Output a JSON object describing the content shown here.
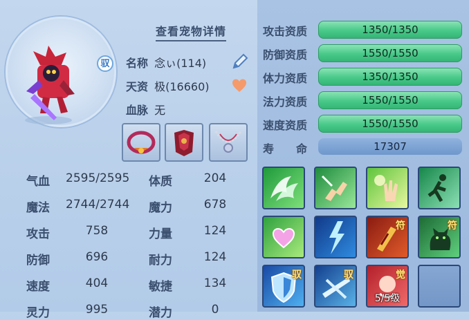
{
  "header": {
    "detail_link": "查看宠物详情"
  },
  "pet": {
    "badge": "驭",
    "name_label": "名称",
    "name_value": "念ぃ(114)",
    "talent_label": "天资",
    "talent_value": "极(16660)",
    "blood_label": "血脉",
    "blood_value": "无"
  },
  "equipment": [
    {
      "name": "collar-ornament"
    },
    {
      "name": "armor-ornament"
    },
    {
      "name": "necklace-ornament"
    }
  ],
  "stats": [
    {
      "label": "气血",
      "value": "2595/2595",
      "label2": "体质",
      "value2": "204"
    },
    {
      "label": "魔法",
      "value": "2744/2744",
      "label2": "魔力",
      "value2": "678"
    },
    {
      "label": "攻击",
      "value": "758",
      "label2": "力量",
      "value2": "124"
    },
    {
      "label": "防御",
      "value": "696",
      "label2": "耐力",
      "value2": "124"
    },
    {
      "label": "速度",
      "value": "404",
      "label2": "敏捷",
      "value2": "134"
    },
    {
      "label": "灵力",
      "value": "995",
      "label2": "潜力",
      "value2": "0"
    }
  ],
  "aptitudes": [
    {
      "label": "攻击资质",
      "value": "1350/1350"
    },
    {
      "label": "防御资质",
      "value": "1550/1550"
    },
    {
      "label": "体力资质",
      "value": "1350/1350"
    },
    {
      "label": "法力资质",
      "value": "1550/1550"
    },
    {
      "label": "速度资质",
      "value": "1550/1550"
    }
  ],
  "lifespan": {
    "label": "寿　　命",
    "value": "17307"
  },
  "skills": [
    {
      "icon": "wings-skill-icon",
      "tag": "",
      "level": ""
    },
    {
      "icon": "hand-gesture-skill-icon",
      "tag": "",
      "level": ""
    },
    {
      "icon": "palm-light-skill-icon",
      "tag": "",
      "level": ""
    },
    {
      "icon": "running-figure-skill-icon",
      "tag": "",
      "level": ""
    },
    {
      "icon": "heart-skill-icon",
      "tag": "",
      "level": ""
    },
    {
      "icon": "lightning-skill-icon",
      "tag": "",
      "level": ""
    },
    {
      "icon": "red-charm-skill-icon",
      "tag": "符",
      "level": ""
    },
    {
      "icon": "cat-spirit-skill-icon",
      "tag": "符",
      "level": ""
    },
    {
      "icon": "shield-skill-icon",
      "tag": "驭",
      "level": ""
    },
    {
      "icon": "ice-slash-skill-icon",
      "tag": "驭",
      "level": ""
    },
    {
      "icon": "awaken-skill-icon",
      "tag": "觉",
      "level": "5/5级"
    },
    {
      "icon": "empty-slot",
      "tag": "",
      "level": ""
    }
  ],
  "colors": {
    "aptitude_bar": "#48c889",
    "life_bar": "#6f97cc",
    "accent_text": "#3b4f6e"
  }
}
